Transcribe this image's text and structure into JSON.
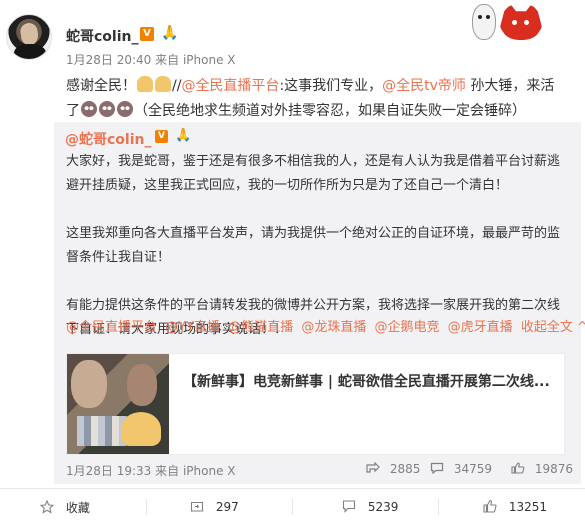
{
  "author": {
    "name": "蛇哥colin_",
    "verified_badge": "V",
    "time": "1月28日 20:40",
    "source": "来自 iPhone X"
  },
  "post": {
    "segments": [
      {
        "text": "感谢全民！",
        "link": false
      },
      {
        "emoji": "pray-icon"
      },
      {
        "emoji": "pray-icon"
      },
      {
        "text": "//",
        "link": false
      },
      {
        "text": "@全民直播平台",
        "link": true
      },
      {
        "text": ":这事我们专业，",
        "link": false
      },
      {
        "text": "@全民tv帝师",
        "link": true
      },
      {
        "text": " 孙大锤，来活了",
        "link": false
      },
      {
        "emoji": "sad-face-icon"
      },
      {
        "emoji": "sad-face-icon"
      },
      {
        "emoji": "sad-face-icon"
      },
      {
        "text": "（全民绝地求生频道对外挂零容忍，如果自证失败一定会锤碎）",
        "link": false
      }
    ]
  },
  "repost": {
    "author": "@蛇哥colin_",
    "verified_badge": "V",
    "paragraphs": [
      "大家好，我是蛇哥，鉴于还是有很多不相信我的人，还是有人认为我是借着平台讨薪逃避开挂质疑，这里我正式回应，我的一切所作所为只是为了还自己一个清白！",
      "这里我郑重向各大直播平台发声，请为我提供一个绝对公正的自证环境，最最严苛的监督条件让我自证！",
      "有能力提供这条件的平台请转发我的微博并公开方案，我将选择一家展开我的第二次线下自证！请大家用现场的事实说话！！"
    ],
    "tags": [
      "@全民直播平台",
      "@YY直播",
      "@熊猫直播",
      "@龙珠直播",
      "@企鹅电竞",
      "@虎牙直播"
    ],
    "collapse_label": "收起全文 ^",
    "card_title": "【新鲜事】电竞新鲜事 | 蛇哥欲借全民直播开展第二次线...",
    "time": "1月28日 19:33",
    "source": "来自 iPhone X",
    "stats": {
      "reposts": "2885",
      "comments": "34759",
      "likes": "19876"
    }
  },
  "actions": {
    "favorite": "收藏",
    "repost": "297",
    "comment": "5239",
    "like": "13251"
  },
  "colors": {
    "link": "#eb7350",
    "badge": "#f08200",
    "repost_bg": "#f2f2f5"
  }
}
